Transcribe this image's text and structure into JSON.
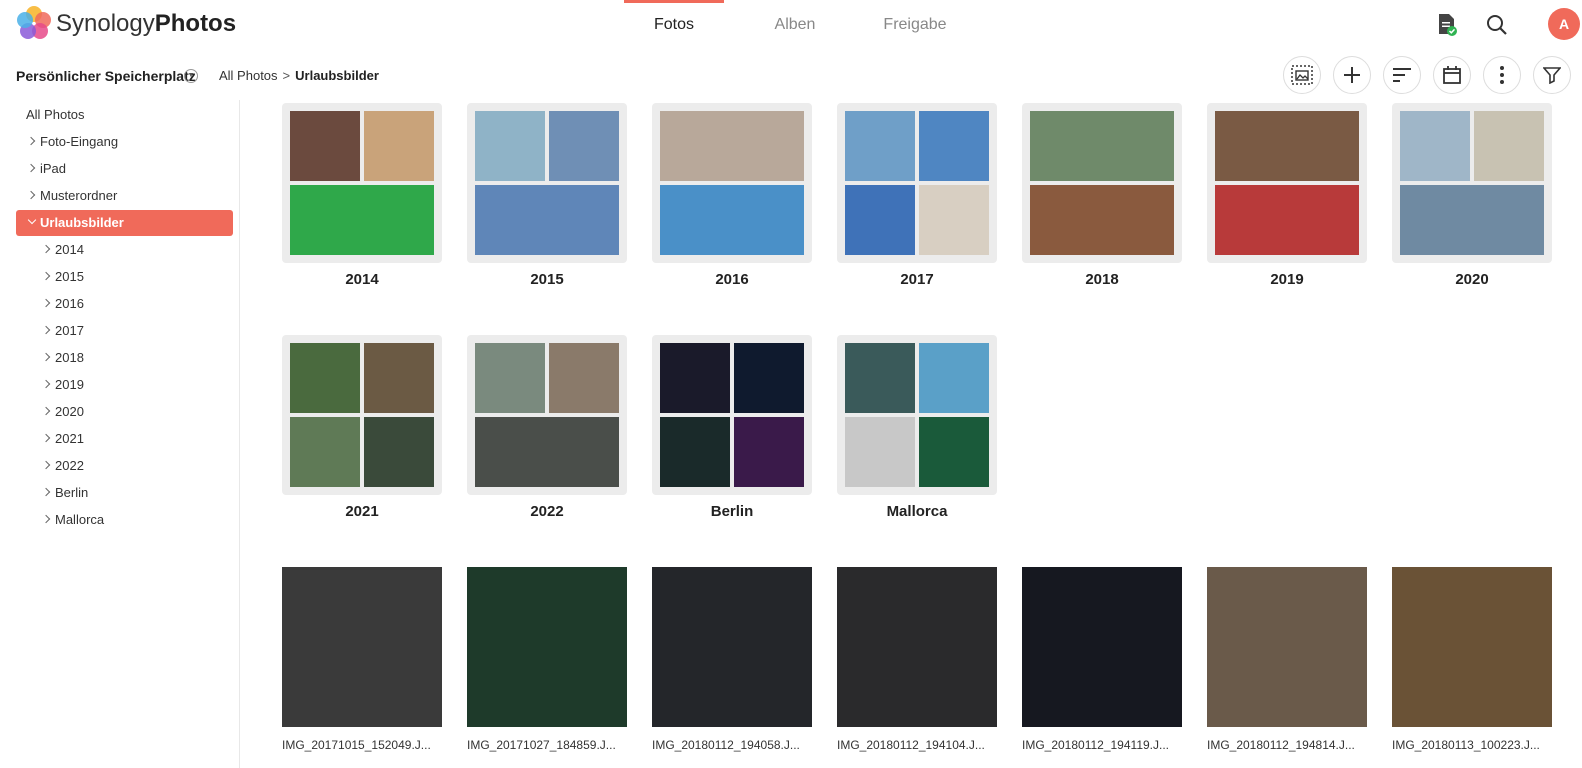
{
  "app": {
    "brand_light": "Synology",
    "brand_bold": "Photos",
    "accent_color": "#f06a5a",
    "user_initial": "A"
  },
  "tabs": [
    {
      "label": "Fotos",
      "active": true
    },
    {
      "label": "Alben",
      "active": false
    },
    {
      "label": "Freigabe",
      "active": false
    }
  ],
  "top_icons": [
    "task-document-icon",
    "search-icon",
    "user-avatar"
  ],
  "subheader": {
    "storage_label": "Persönlicher Speicherplatz",
    "breadcrumb_root": "All Photos",
    "breadcrumb_sep": ">",
    "breadcrumb_current": "Urlaubsbilder"
  },
  "toolbar_icons": [
    "select-images-icon",
    "add-icon",
    "sort-icon",
    "calendar-icon",
    "more-options-icon",
    "filter-icon"
  ],
  "sidebar": {
    "root": "All Photos",
    "items": [
      {
        "label": "Foto-Eingang",
        "level": 1
      },
      {
        "label": "iPad",
        "level": 1
      },
      {
        "label": "Musterordner",
        "level": 1
      },
      {
        "label": "Urlaubsbilder",
        "level": 1,
        "selected": true,
        "expanded": true
      },
      {
        "label": "2014",
        "level": 2
      },
      {
        "label": "2015",
        "level": 2
      },
      {
        "label": "2016",
        "level": 2
      },
      {
        "label": "2017",
        "level": 2
      },
      {
        "label": "2018",
        "level": 2
      },
      {
        "label": "2019",
        "level": 2
      },
      {
        "label": "2020",
        "level": 2
      },
      {
        "label": "2021",
        "level": 2
      },
      {
        "label": "2022",
        "level": 2
      },
      {
        "label": "Berlin",
        "level": 2
      },
      {
        "label": "Mallorca",
        "level": 2
      }
    ]
  },
  "folders": [
    {
      "title": "2014",
      "layout": "2top1bottom",
      "colors": [
        "#6b4a3e",
        "#c9a37a",
        "#2fa84a"
      ]
    },
    {
      "title": "2015",
      "layout": "2top1bottom",
      "colors": [
        "#8fb3c7",
        "#6f8fb5",
        "#5f86b8"
      ]
    },
    {
      "title": "2016",
      "layout": "1top1bottom",
      "colors": [
        "#b8a89a",
        "#4a90c8"
      ]
    },
    {
      "title": "2017",
      "layout": "grid4",
      "colors": [
        "#6f9fc8",
        "#4f86c2",
        "#3f72b8",
        "#d8cfc2"
      ]
    },
    {
      "title": "2018",
      "layout": "1top1bottom",
      "colors": [
        "#6f8a6a",
        "#8a5a3e"
      ]
    },
    {
      "title": "2019",
      "layout": "1top1bottom",
      "colors": [
        "#7a5a44",
        "#b83a3a"
      ]
    },
    {
      "title": "2020",
      "layout": "2top1bottom",
      "colors": [
        "#9fb6c8",
        "#c8c2b2",
        "#6f8aa2"
      ]
    },
    {
      "title": "2021",
      "layout": "grid4",
      "colors": [
        "#4a6a3e",
        "#6b5a44",
        "#5f7a56",
        "#3a4a3a"
      ]
    },
    {
      "title": "2022",
      "layout": "2top1bottom",
      "colors": [
        "#7a8a7e",
        "#8a7a6a",
        "#4a4e4a"
      ]
    },
    {
      "title": "Berlin",
      "layout": "grid4",
      "colors": [
        "#1a1a2a",
        "#0f1a2e",
        "#1a2a2a",
        "#3a1a4a"
      ]
    },
    {
      "title": "Mallorca",
      "layout": "grid4",
      "colors": [
        "#3a5a5a",
        "#5aa0c8",
        "#c8c8c8",
        "#1a5a3a"
      ]
    }
  ],
  "photos": [
    {
      "name": "IMG_20171015_152049.J...",
      "color": "#3a3a3a"
    },
    {
      "name": "IMG_20171027_184859.J...",
      "color": "#1e3a2a"
    },
    {
      "name": "IMG_20180112_194058.J...",
      "color": "#24262a"
    },
    {
      "name": "IMG_20180112_194104.J...",
      "color": "#2a2a2c"
    },
    {
      "name": "IMG_20180112_194119.J...",
      "color": "#161820"
    },
    {
      "name": "IMG_20180112_194814.J...",
      "color": "#6a5a4a"
    },
    {
      "name": "IMG_20180113_100223.J...",
      "color": "#6a5236"
    }
  ]
}
